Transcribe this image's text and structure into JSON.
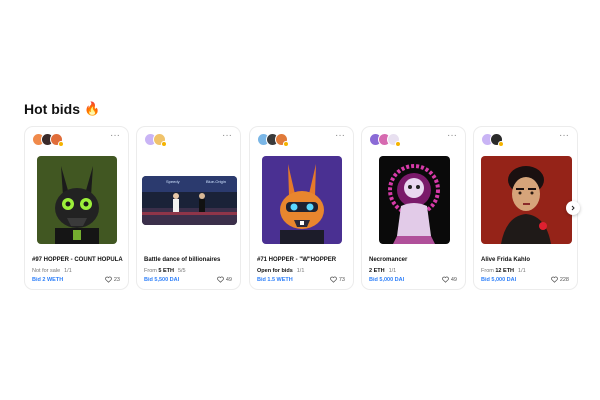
{
  "section": {
    "title": "Hot bids",
    "emoji": "🔥"
  },
  "cards": [
    {
      "name": "#97 HOPPER - COUNT HOPULA",
      "price_prefix": "",
      "price_value": "Not for sale",
      "edition": "1/1",
      "bid": "Bid 2 WETH",
      "likes": "23"
    },
    {
      "name": "Battle dance of billionaires",
      "price_prefix": "From ",
      "price_value": "5 ETH",
      "edition": "5/5",
      "bid": "Bid 5,500 DAI",
      "likes": "49",
      "art_caption_left": "Speedy",
      "art_caption_right": "Blue-Origin"
    },
    {
      "name": "#71 HOPPER - \"W\"HOPPER",
      "price_prefix": "",
      "price_value": "Open for bids",
      "edition": "1/1",
      "bid": "Bid 1.5 WETH",
      "likes": "73"
    },
    {
      "name": "Necromancer",
      "price_prefix": "",
      "price_value": "2 ETH",
      "edition": "1/1",
      "bid": "Bid 5,000 DAI",
      "likes": "49"
    },
    {
      "name": "Alive Frida Kahlo",
      "price_prefix": "From ",
      "price_value": "12 ETH",
      "edition": "1/1",
      "bid": "Bid 5,000 DAI",
      "likes": "228"
    }
  ],
  "colors": {
    "bid": "#2d7ff9",
    "verified": "#f5b400"
  },
  "icons": {
    "more": "more-dots-icon",
    "like": "heart-icon",
    "next": "chevron-right-icon"
  }
}
